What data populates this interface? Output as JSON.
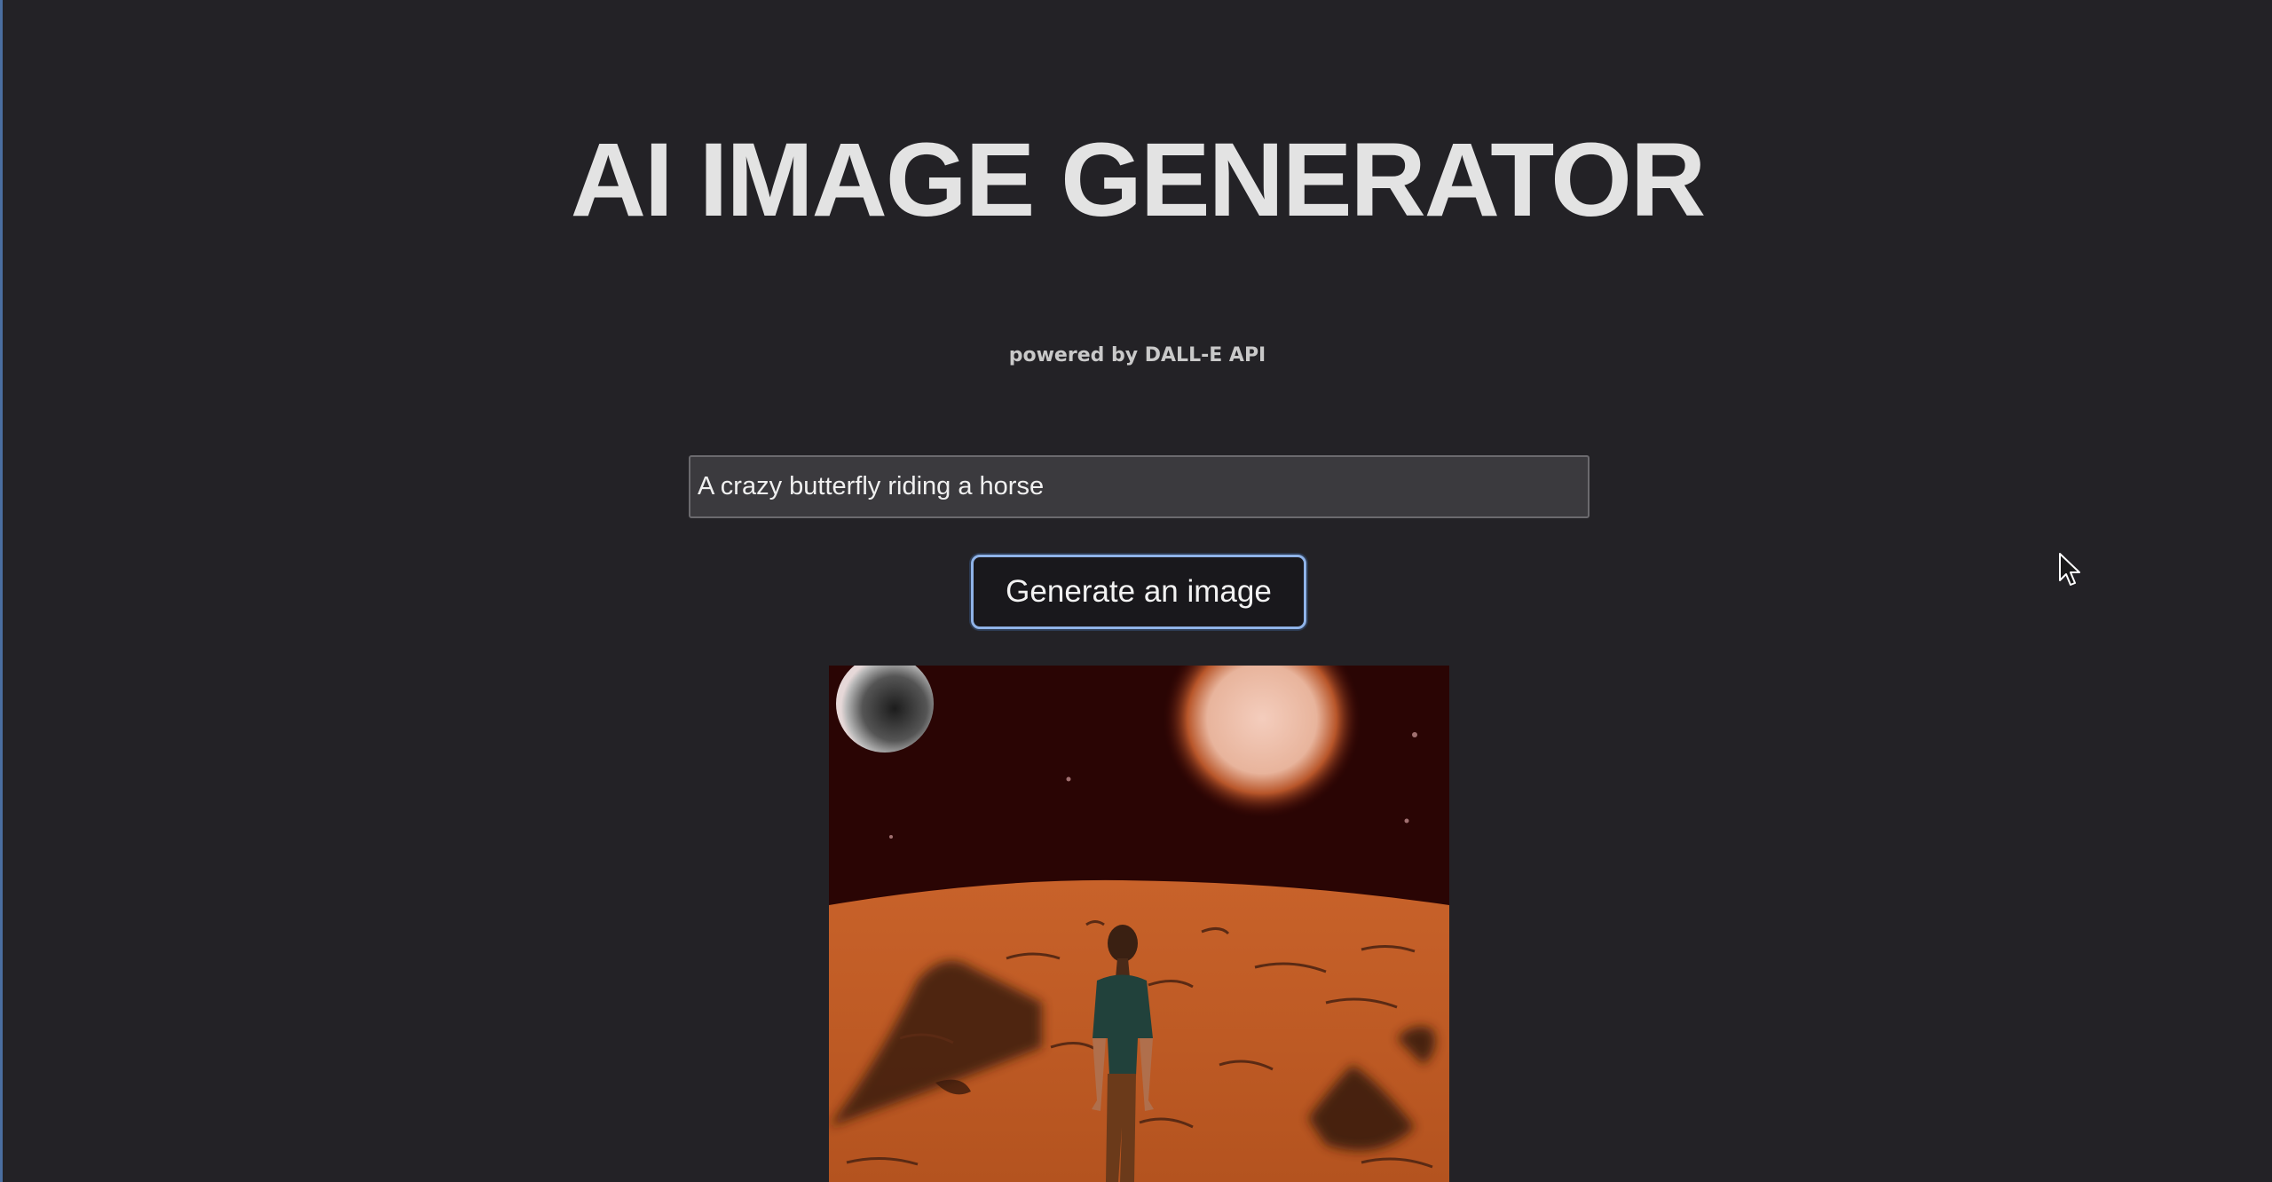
{
  "header": {
    "title": "AI IMAGE GENERATOR",
    "subtitle": "powered by DALL-E API"
  },
  "form": {
    "prompt_value": "A crazy butterfly riding a horse",
    "generate_label": "Generate an image"
  },
  "result": {
    "alt": "Generated image: a person standing on an orange desert planet under a red sky with a glowing sun and a grey moon"
  },
  "colors": {
    "background": "#232226",
    "button_border": "#8fb3e8",
    "input_background": "#3b3a3e"
  },
  "icons": {
    "cursor": "mouse-pointer-icon"
  }
}
